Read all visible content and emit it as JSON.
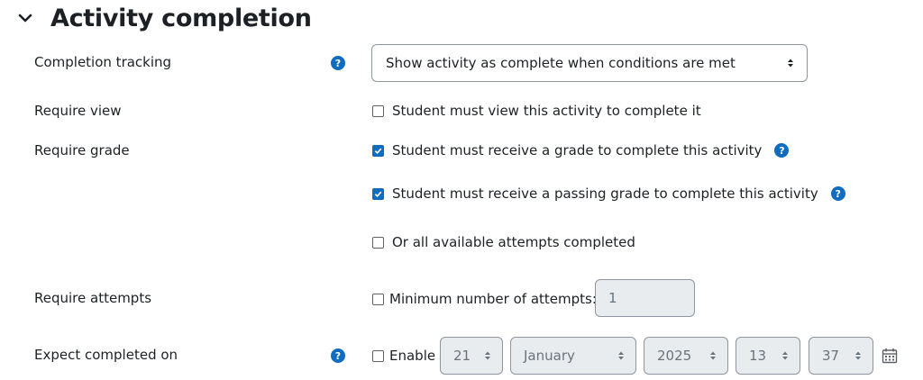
{
  "section": {
    "title": "Activity completion",
    "icon": "chevron-down-icon"
  },
  "fields": {
    "completion_tracking": {
      "label": "Completion tracking",
      "help_icon": "question-circle-icon",
      "selected": "Show activity as complete when conditions are met"
    },
    "require_view": {
      "label": "Require view",
      "checkbox_label": "Student must view this activity to complete it",
      "checked": false
    },
    "require_grade": {
      "label": "Require grade",
      "options": [
        {
          "text": "Student must receive a grade to complete this activity",
          "checked": true,
          "has_help": true
        },
        {
          "text": "Student must receive a passing grade to complete this activity",
          "checked": true,
          "has_help": true
        },
        {
          "text": "Or all available attempts completed",
          "checked": false,
          "has_help": false
        }
      ]
    },
    "require_attempts": {
      "label": "Require attempts",
      "checkbox_label": "Minimum number of attempts:",
      "checked": false,
      "value": "1"
    },
    "expect_completed": {
      "label": "Expect completed on",
      "enable_label": "Enable",
      "enabled": false,
      "day": "21",
      "month": "January",
      "year": "2025",
      "hour": "13",
      "minute": "37",
      "calendar_icon": "calendar-icon"
    }
  },
  "colors": {
    "primary": "#0f6cbf",
    "text": "#1d2125",
    "disabled_bg": "#e9ecef",
    "border": "#8f959e"
  }
}
